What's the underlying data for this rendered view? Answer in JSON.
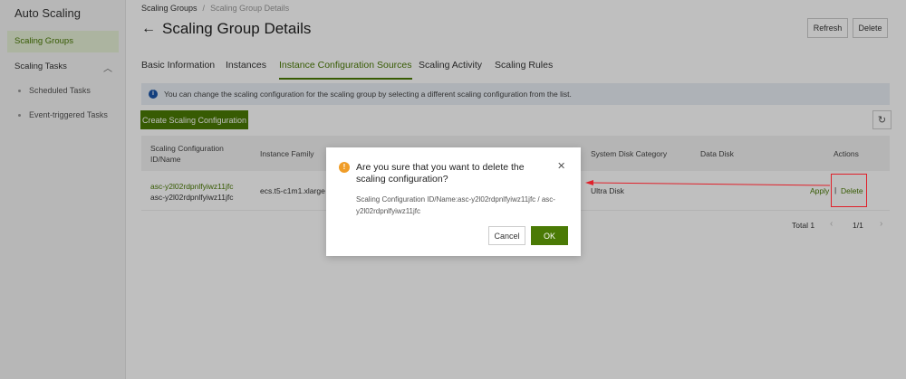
{
  "sidebar": {
    "title": "Auto Scaling",
    "active_item": "Scaling Groups",
    "group_label": "Scaling Tasks",
    "sub_items": [
      "Scheduled Tasks",
      "Event-triggered Tasks"
    ]
  },
  "breadcrumb": {
    "parent": "Scaling Groups",
    "separator": "/",
    "current": "Scaling Group Details"
  },
  "header": {
    "title": "Scaling Group Details",
    "refresh_label": "Refresh",
    "delete_label": "Delete"
  },
  "tabs": [
    {
      "label": "Basic Information"
    },
    {
      "label": "Instances"
    },
    {
      "label": "Instance Configuration Sources"
    },
    {
      "label": "Scaling Activity"
    },
    {
      "label": "Scaling Rules"
    }
  ],
  "active_tab": "Instance Configuration Sources",
  "info_message": "You can change the scaling configuration for the scaling group by selecting a different scaling configuration from the list.",
  "toolbar": {
    "create_label": "Create Scaling Configuration"
  },
  "table": {
    "columns": {
      "id_name_line1": "Scaling Configuration",
      "id_name_line2": "ID/Name",
      "instance_family": "Instance Family",
      "system_disk": "System Disk Category",
      "data_disk": "Data Disk",
      "actions": "Actions"
    },
    "rows": [
      {
        "id": "asc-y2l02rdpnlfyiwz11jfc",
        "name": "asc-y2l02rdpnlfyiwz11jfc",
        "instance_family": "ecs.t5-c1m1.xlarge",
        "system_disk": "Ultra Disk",
        "data_disk": "",
        "action_apply": "Apply",
        "action_delete": "Delete"
      }
    ]
  },
  "pagination": {
    "total": "Total 1",
    "page": "1/1"
  },
  "dialog": {
    "title": "Are you sure that you want to delete the scaling configuration?",
    "body": "Scaling Configuration ID/Name:asc-y2l02rdpnlfyiwz11jfc / asc-y2l02rdpnlfyiwz11jfc",
    "cancel_label": "Cancel",
    "ok_label": "OK"
  },
  "colors": {
    "accent": "#4a7a05",
    "annotation": "#e0202a",
    "warning": "#f09d28",
    "info": "#1a55a8"
  }
}
